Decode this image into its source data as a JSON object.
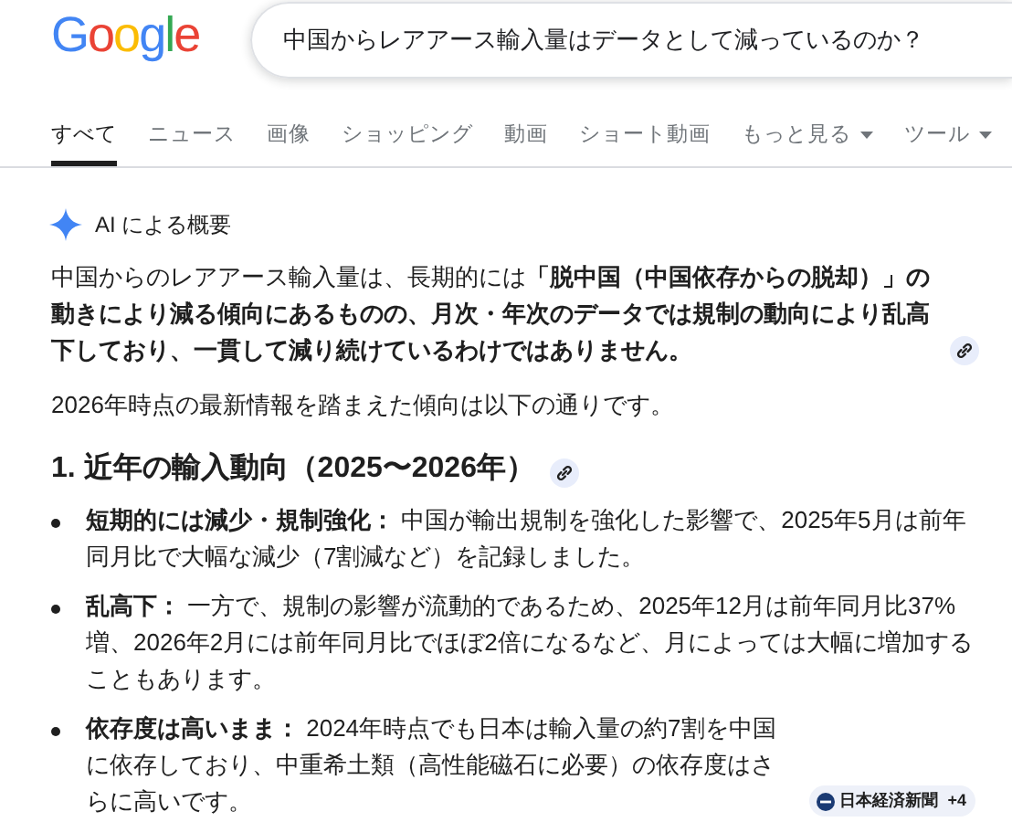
{
  "header": {
    "logo": "Google",
    "search": {
      "value": "中国からレアアース輸入量はデータとして減っているのか？"
    }
  },
  "tabs": [
    {
      "label": "すべて",
      "selected": true,
      "kind": "plain"
    },
    {
      "label": "ニュース",
      "selected": false,
      "kind": "plain"
    },
    {
      "label": "画像",
      "selected": false,
      "kind": "plain"
    },
    {
      "label": "ショッピング",
      "selected": false,
      "kind": "plain"
    },
    {
      "label": "動画",
      "selected": false,
      "kind": "plain"
    },
    {
      "label": "ショート動画",
      "selected": false,
      "kind": "plain"
    },
    {
      "label": "もっと見る",
      "selected": false,
      "kind": "dropdown"
    },
    {
      "label": "ツール",
      "selected": false,
      "kind": "dropdown"
    }
  ],
  "overview": {
    "title": "AI による概要",
    "blocks": [
      {
        "kind": "paragraph",
        "text": "中国からのレアアース輸入量は、長期的には**「脱中国（中国依存からの脱却）」の動きにより減る傾向にあるものの、月次・年次のデータでは規制の動向により乱高下しており、一貫して減り続けているわけではありません。**",
        "link": true
      },
      {
        "kind": "paragraph",
        "text": "2026年時点の最新情報を踏まえた傾向は以下の通りです。",
        "link": false
      },
      {
        "kind": "heading",
        "text": "1. 近年の輸入動向（2025〜2026年）",
        "link": true
      },
      {
        "kind": "bullets",
        "items": [
          {
            "text": "**短期的には減少・規制強化：** 中国が輸出規制を強化した影響で、2025年5月は前年同月比で大幅な減少（7割減など）を記録しました。"
          },
          {
            "text": "**乱高下：** 一方で、規制の影響が流動的であるため、2025年12月は前年同月比37%増、2026年2月には前年同月比でほぼ2倍になるなど、月によっては大幅に増加することもあります。"
          },
          {
            "text": "**依存度は高いまま：** 2024年時点でも日本は輸入量の約7割を中国に依存しており、中重希土類（高性能磁石に必要）の依存度はさらに高いです。",
            "source": "日本経済新聞",
            "more": "+4"
          }
        ]
      }
    ]
  }
}
